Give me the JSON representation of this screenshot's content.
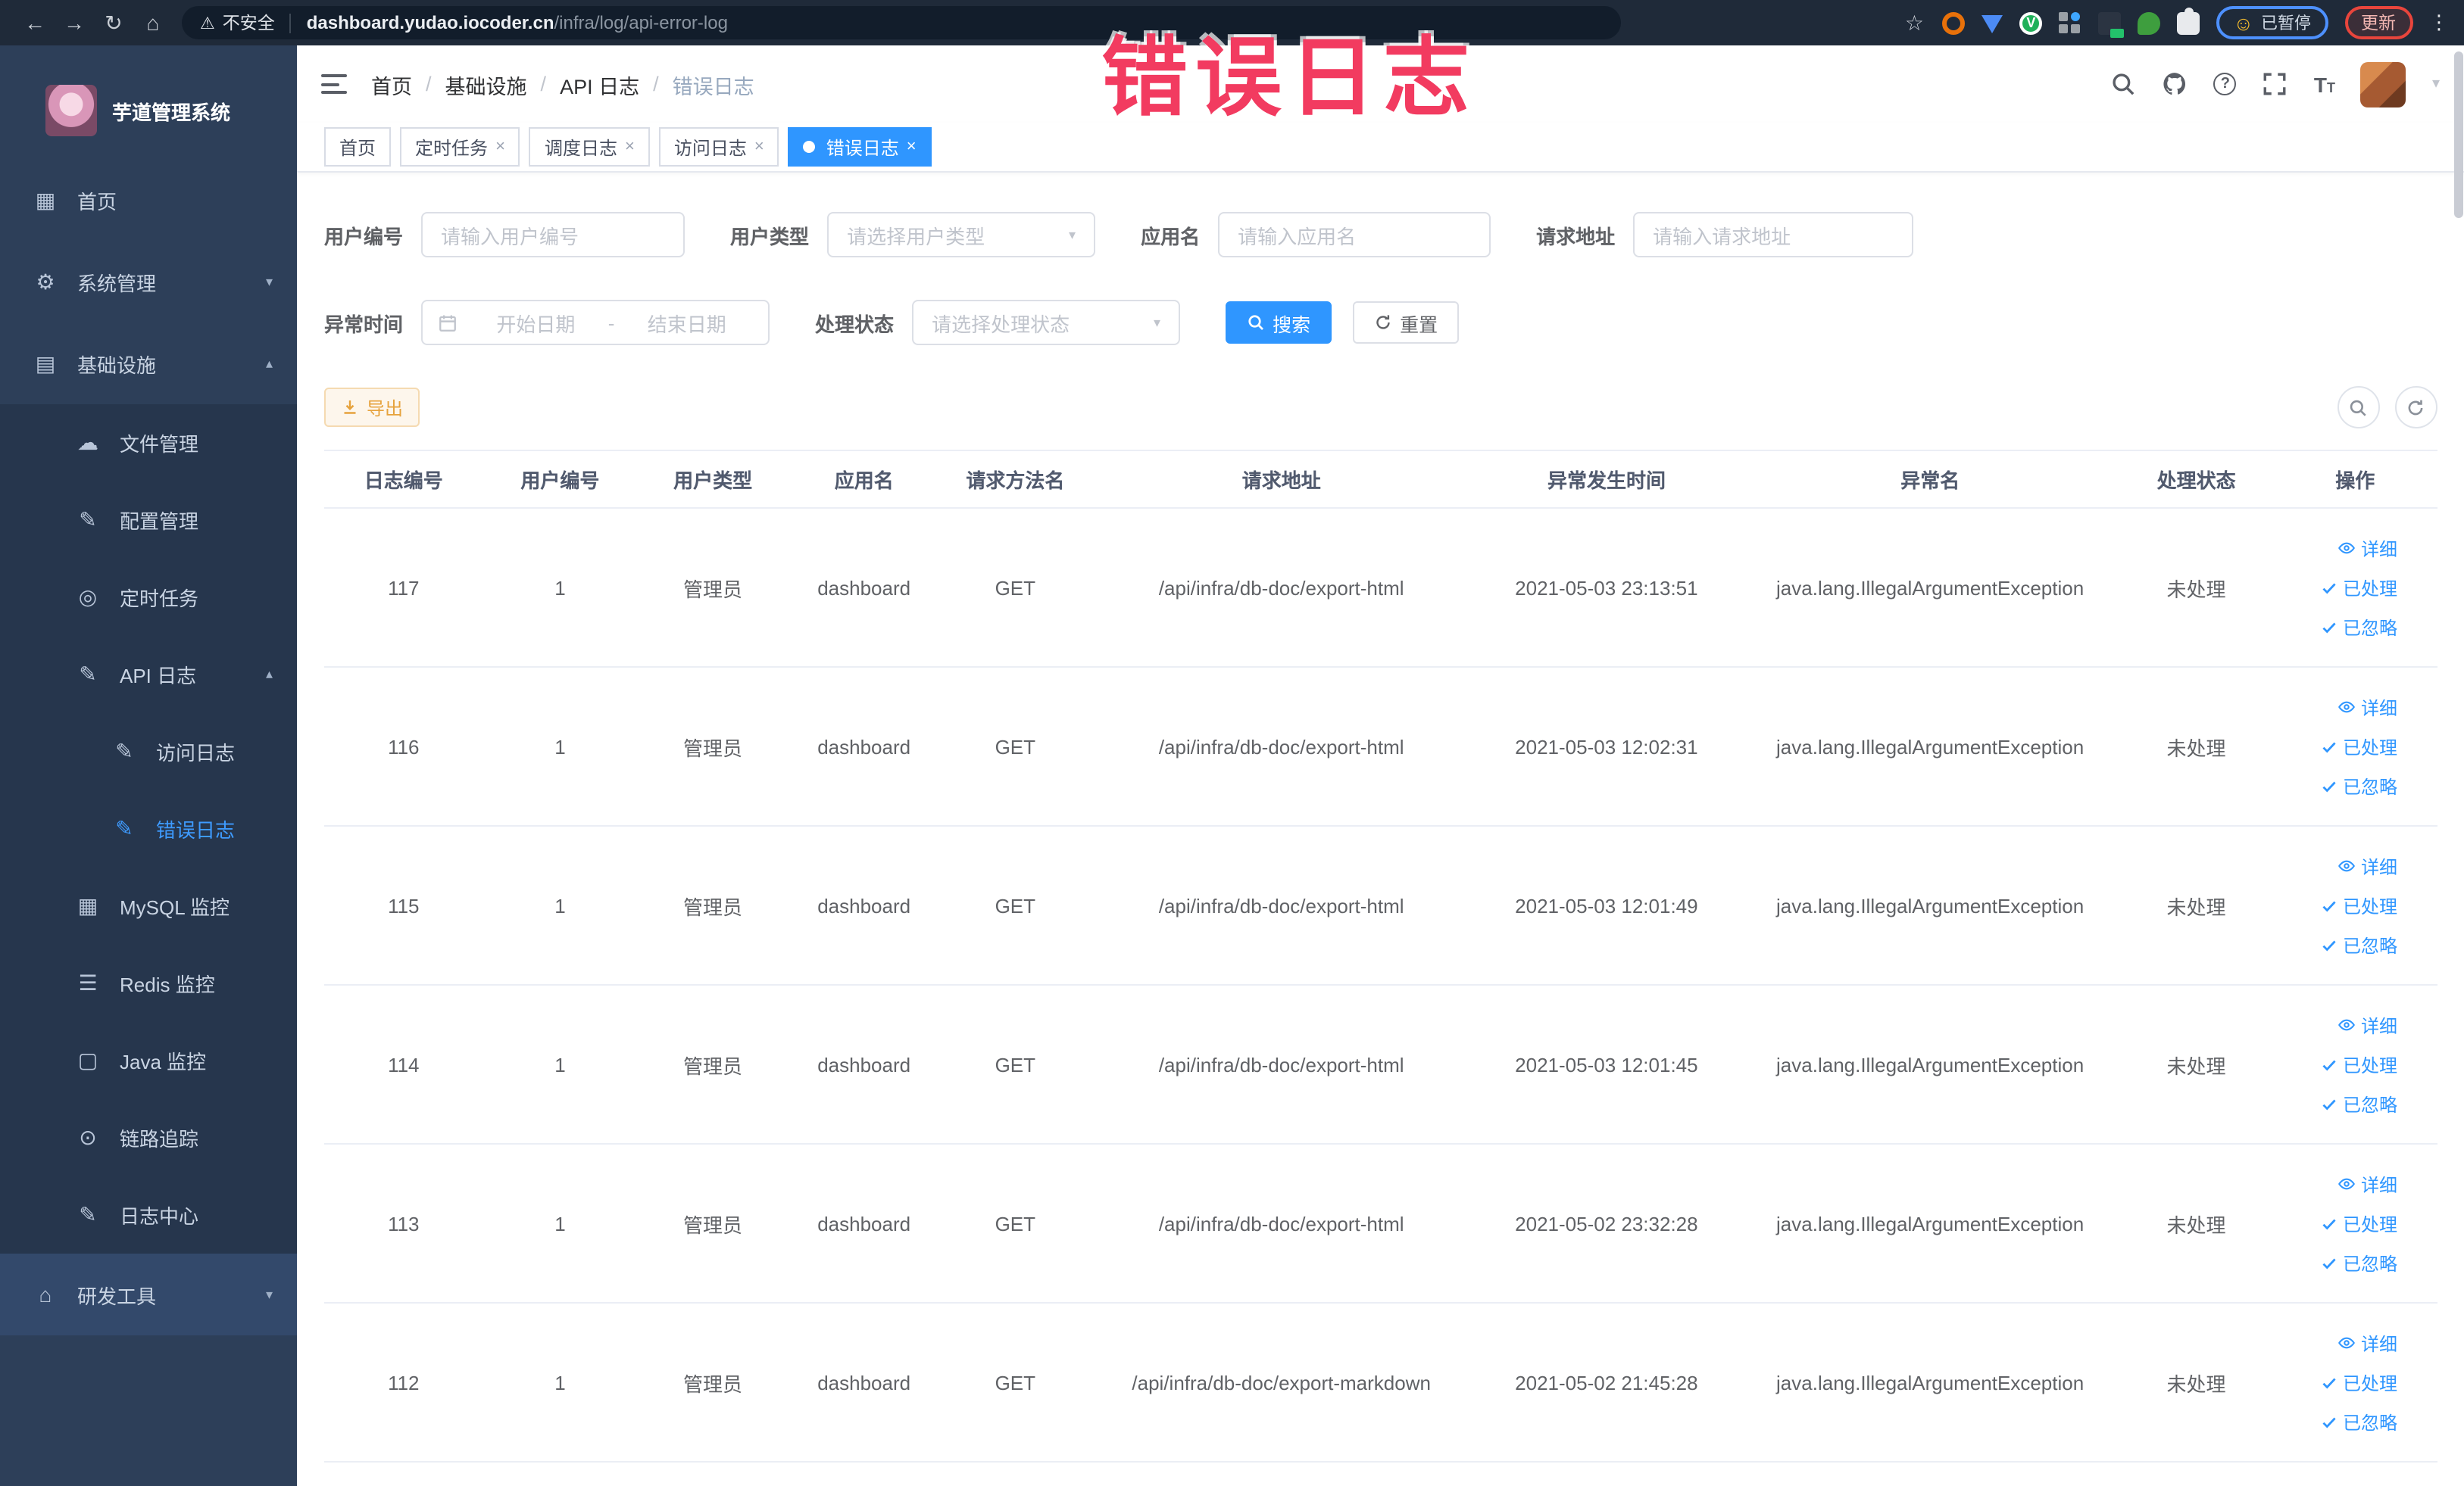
{
  "browser": {
    "security_label": "不安全",
    "url_host": "dashboard.yudao.iocoder.cn",
    "url_path": "/infra/log/api-error-log",
    "paused_label": "已暂停",
    "update_label": "更新"
  },
  "annotation": {
    "text": "错误日志",
    "color": "#f23b60"
  },
  "icons": {
    "back": "←",
    "forward": "→",
    "reload": "↻",
    "home_nav": "⌂",
    "warning": "⚠",
    "star": "☆",
    "dots": "⋮",
    "caret": "▾",
    "smiley": "☺",
    "close": "×",
    "question": "?",
    "font_big": "T",
    "font_small": "T",
    "home": "▦",
    "gear": "⚙",
    "infra": "▤",
    "tools": "⌂",
    "file": "☁",
    "config": "✎",
    "job": "◎",
    "apilog": "✎",
    "access": "✎",
    "error": "✎",
    "mysql": "▦",
    "redis": "☰",
    "java": "▢",
    "trace": "⊙",
    "logcenter": "✎",
    "chevron_down": "▾",
    "chevron_up": "▴",
    "select_caret": "▾"
  },
  "sidebar": {
    "title": "芋道管理系统",
    "items": [
      {
        "label": "首页"
      },
      {
        "label": "系统管理"
      },
      {
        "label": "基础设施"
      },
      {
        "label": "研发工具"
      }
    ],
    "submenu": [
      {
        "label": "文件管理"
      },
      {
        "label": "配置管理"
      },
      {
        "label": "定时任务"
      },
      {
        "label": "API 日志"
      },
      {
        "label": "访问日志"
      },
      {
        "label": "错误日志"
      },
      {
        "label": "MySQL 监控"
      },
      {
        "label": "Redis 监控"
      },
      {
        "label": "Java 监控"
      },
      {
        "label": "链路追踪"
      },
      {
        "label": "日志中心"
      }
    ]
  },
  "header": {
    "breadcrumb": [
      "首页",
      "基础设施",
      "API 日志",
      "错误日志"
    ]
  },
  "tags": [
    {
      "label": "首页"
    },
    {
      "label": "定时任务"
    },
    {
      "label": "调度日志"
    },
    {
      "label": "访问日志"
    },
    {
      "label": "错误日志"
    }
  ],
  "filters": {
    "user_id_label": "用户编号",
    "user_id_placeholder": "请输入用户编号",
    "user_type_label": "用户类型",
    "user_type_placeholder": "请选择用户类型",
    "app_label": "应用名",
    "app_placeholder": "请输入应用名",
    "url_label": "请求地址",
    "url_placeholder": "请输入请求地址",
    "time_label": "异常时间",
    "start_placeholder": "开始日期",
    "range_separator": "-",
    "end_placeholder": "结束日期",
    "status_label": "处理状态",
    "status_placeholder": "请选择处理状态",
    "search_label": "搜索",
    "reset_label": "重置",
    "export_label": "导出"
  },
  "table": {
    "headers": [
      "日志编号",
      "用户编号",
      "用户类型",
      "应用名",
      "请求方法名",
      "请求地址",
      "异常发生时间",
      "异常名",
      "处理状态",
      "操作"
    ],
    "action_labels": [
      "详细",
      "已处理",
      "已忽略"
    ],
    "rows": [
      {
        "id": "117",
        "user_id": "1",
        "user_type": "管理员",
        "app": "dashboard",
        "method": "GET",
        "url": "/api/infra/db-doc/export-html",
        "time": "2021-05-03 23:13:51",
        "exception": "java.lang.IllegalArgumentException",
        "status": "未处理"
      },
      {
        "id": "116",
        "user_id": "1",
        "user_type": "管理员",
        "app": "dashboard",
        "method": "GET",
        "url": "/api/infra/db-doc/export-html",
        "time": "2021-05-03 12:02:31",
        "exception": "java.lang.IllegalArgumentException",
        "status": "未处理"
      },
      {
        "id": "115",
        "user_id": "1",
        "user_type": "管理员",
        "app": "dashboard",
        "method": "GET",
        "url": "/api/infra/db-doc/export-html",
        "time": "2021-05-03 12:01:49",
        "exception": "java.lang.IllegalArgumentException",
        "status": "未处理"
      },
      {
        "id": "114",
        "user_id": "1",
        "user_type": "管理员",
        "app": "dashboard",
        "method": "GET",
        "url": "/api/infra/db-doc/export-html",
        "time": "2021-05-03 12:01:45",
        "exception": "java.lang.IllegalArgumentException",
        "status": "未处理"
      },
      {
        "id": "113",
        "user_id": "1",
        "user_type": "管理员",
        "app": "dashboard",
        "method": "GET",
        "url": "/api/infra/db-doc/export-html",
        "time": "2021-05-02 23:32:28",
        "exception": "java.lang.IllegalArgumentException",
        "status": "未处理"
      },
      {
        "id": "112",
        "user_id": "1",
        "user_type": "管理员",
        "app": "dashboard",
        "method": "GET",
        "url": "/api/infra/db-doc/export-markdown",
        "time": "2021-05-02 21:45:28",
        "exception": "java.lang.IllegalArgumentException",
        "status": "未处理"
      }
    ]
  }
}
